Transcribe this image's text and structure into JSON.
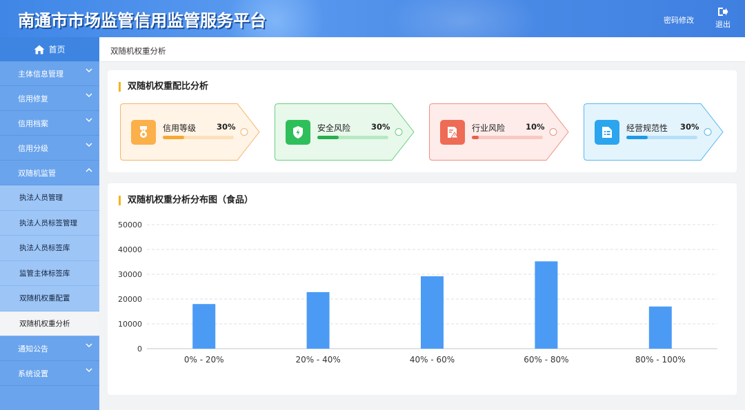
{
  "header": {
    "title": "南通市市场监管信用监管服务平台",
    "password_label": "密码修改",
    "logout_label": "退出"
  },
  "sidebar": {
    "home": "首页",
    "items": [
      {
        "label": "主体信息管理",
        "expanded": false
      },
      {
        "label": "信用修复",
        "expanded": false
      },
      {
        "label": "信用档案",
        "expanded": false
      },
      {
        "label": "信用分级",
        "expanded": false
      },
      {
        "label": "双随机监管",
        "expanded": true
      }
    ],
    "subitems": [
      {
        "label": "执法人员管理",
        "active": false
      },
      {
        "label": "执法人员标签管理",
        "active": false
      },
      {
        "label": "执法人员标签库",
        "active": false
      },
      {
        "label": "监管主体标签库",
        "active": false
      },
      {
        "label": "双随机权重配置",
        "active": false
      },
      {
        "label": "双随机权重分析",
        "active": true
      }
    ],
    "bottom_items": [
      {
        "label": "通知公告",
        "expanded": false
      },
      {
        "label": "系统设置",
        "expanded": false
      }
    ]
  },
  "breadcrumb": "双随机权重分析",
  "ratio_card": {
    "title": "双随机权重配比分析",
    "tags": [
      {
        "label": "信用等级",
        "percent": "30%",
        "value": 0.3,
        "icon": "medal-icon",
        "colors": {
          "border": "#f5b36a",
          "bg": "#fff4e6",
          "icon_bg": "#fbb04a",
          "track": "#fde0bb",
          "fill": "#f7a833"
        }
      },
      {
        "label": "安全风险",
        "percent": "30%",
        "value": 0.3,
        "icon": "shield-icon",
        "colors": {
          "border": "#67cf7f",
          "bg": "#e8f8eb",
          "icon_bg": "#2fbf5a",
          "track": "#b6e9c3",
          "fill": "#27b04e"
        }
      },
      {
        "label": "行业风险",
        "percent": "10%",
        "value": 0.1,
        "icon": "warning-doc-icon",
        "colors": {
          "border": "#f08f80",
          "bg": "#fdecea",
          "icon_bg": "#ee6b55",
          "track": "#f9c9c1",
          "fill": "#ec5f48"
        }
      },
      {
        "label": "经营规范性",
        "percent": "30%",
        "value": 0.3,
        "icon": "document-icon",
        "colors": {
          "border": "#5ab6ee",
          "bg": "#e4f4fd",
          "icon_bg": "#2aa5ee",
          "track": "#b5e0f8",
          "fill": "#1e9ae8"
        }
      }
    ]
  },
  "chart_card": {
    "title": "双随机权重分析分布图（食品）"
  },
  "chart_data": {
    "type": "bar",
    "categories": [
      "0% - 20%",
      "20% - 40%",
      "40% - 60%",
      "60% - 80%",
      "80% - 100%"
    ],
    "values": [
      18000,
      22800,
      29200,
      35200,
      17000
    ],
    "yticks": [
      "0",
      "10000",
      "20000",
      "30000",
      "40000",
      "50000"
    ],
    "ylim": [
      0,
      50000
    ],
    "color": "#4b9bf5",
    "grid": true
  }
}
